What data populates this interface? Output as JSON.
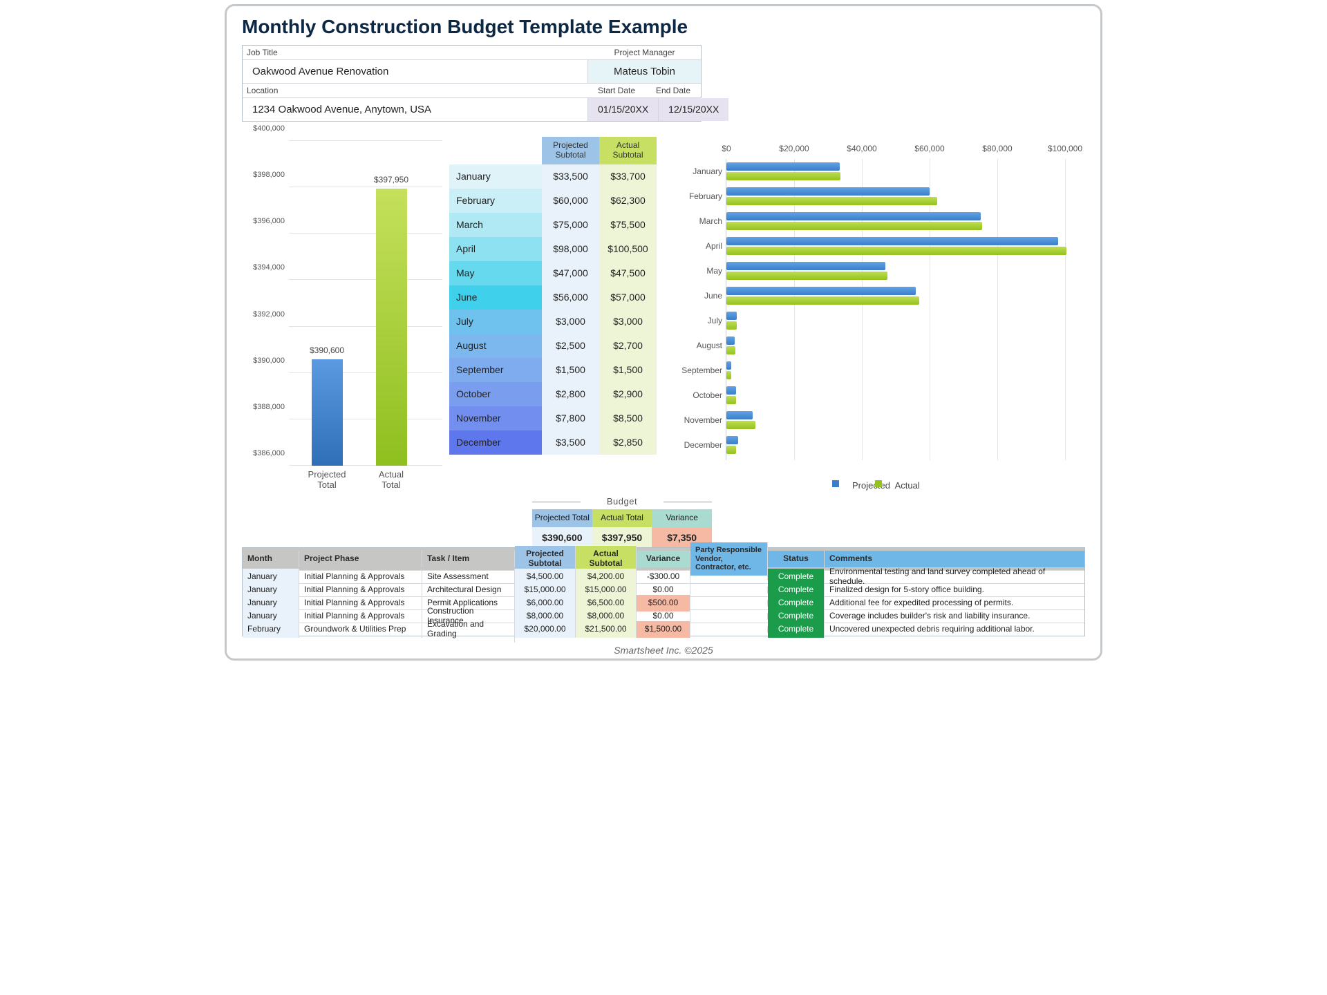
{
  "title": "Monthly Construction Budget Template Example",
  "footer": "Smartsheet Inc. ©2025",
  "header": {
    "job_title_label": "Job Title",
    "job_title": "Oakwood Avenue Renovation",
    "pm_label": "Project Manager",
    "pm": "Mateus Tobin",
    "location_label": "Location",
    "location": "1234 Oakwood Avenue, Anytown, USA",
    "start_label": "Start Date",
    "start": "01/15/20XX",
    "end_label": "End Date",
    "end": "12/15/20XX"
  },
  "chart_data": [
    {
      "type": "bar",
      "categories": [
        "Projected\nTotal",
        "Actual\nTotal"
      ],
      "values": [
        390600,
        397950
      ],
      "data_labels": [
        "$390,600",
        "$397,950"
      ],
      "ylim": [
        386000,
        400000
      ],
      "yticks": [
        "$386,000",
        "$388,000",
        "$390,000",
        "$392,000",
        "$394,000",
        "$396,000",
        "$398,000",
        "$400,000"
      ]
    },
    {
      "type": "bar",
      "orientation": "horizontal",
      "categories": [
        "January",
        "February",
        "March",
        "April",
        "May",
        "June",
        "July",
        "August",
        "September",
        "October",
        "November",
        "December"
      ],
      "series": [
        {
          "name": "Projected",
          "values": [
            33500,
            60000,
            75000,
            98000,
            47000,
            56000,
            3000,
            2500,
            1500,
            2800,
            7800,
            3500
          ]
        },
        {
          "name": "Actual",
          "values": [
            33700,
            62300,
            75500,
            100500,
            47500,
            57000,
            3000,
            2700,
            1500,
            2900,
            8500,
            2850
          ]
        }
      ],
      "xticks": [
        0,
        20000,
        40000,
        60000,
        80000,
        100000
      ],
      "xtick_labels": [
        "$0",
        "$20,000",
        "$40,000",
        "$60,000",
        "$80,000",
        "$100,000"
      ],
      "legend": [
        "Projected",
        "Actual"
      ]
    }
  ],
  "month_table": {
    "headers": {
      "proj": "Projected Subtotal",
      "act": "Actual Subtotal"
    },
    "rows": [
      {
        "m": "January",
        "p": "$33,500",
        "a": "$33,700",
        "c": "#dff3f9"
      },
      {
        "m": "February",
        "p": "$60,000",
        "a": "$62,300",
        "c": "#cbeff7"
      },
      {
        "m": "March",
        "p": "$75,000",
        "a": "$75,500",
        "c": "#b0e9f4"
      },
      {
        "m": "April",
        "p": "$98,000",
        "a": "$100,500",
        "c": "#8de1f1"
      },
      {
        "m": "May",
        "p": "$47,000",
        "a": "$47,500",
        "c": "#67d9ee"
      },
      {
        "m": "June",
        "p": "$56,000",
        "a": "$57,000",
        "c": "#3fd0ec"
      },
      {
        "m": "July",
        "p": "$3,000",
        "a": "$3,000",
        "c": "#6fc2ee"
      },
      {
        "m": "August",
        "p": "$2,500",
        "a": "$2,700",
        "c": "#7cb8ee"
      },
      {
        "m": "September",
        "p": "$1,500",
        "a": "$1,500",
        "c": "#7facee"
      },
      {
        "m": "October",
        "p": "$2,800",
        "a": "$2,900",
        "c": "#7a9dee"
      },
      {
        "m": "November",
        "p": "$7,800",
        "a": "$8,500",
        "c": "#728eee"
      },
      {
        "m": "December",
        "p": "$3,500",
        "a": "$2,850",
        "c": "#5f77ec"
      }
    ]
  },
  "budget": {
    "title": "Budget",
    "headers": [
      "Projected Total",
      "Actual Total",
      "Variance"
    ],
    "values": [
      "$390,600",
      "$397,950",
      "$7,350"
    ]
  },
  "detail": {
    "headers": [
      "Month",
      "Project Phase",
      "Task / Item",
      "Projected Subtotal",
      "Actual Subtotal",
      "Variance",
      "Party Responsible Vendor, Contractor, etc.",
      "Status",
      "Comments"
    ],
    "rows": [
      {
        "m": "January",
        "ph": "Initial Planning & Approvals",
        "t": "Site Assessment",
        "p": "$4,500.00",
        "a": "$4,200.00",
        "v": "-$300.00",
        "pr": "",
        "s": "Complete",
        "c": "Environmental testing and land survey completed ahead of schedule.",
        "vpos": false
      },
      {
        "m": "January",
        "ph": "Initial Planning & Approvals",
        "t": "Architectural Design",
        "p": "$15,000.00",
        "a": "$15,000.00",
        "v": "$0.00",
        "pr": "",
        "s": "Complete",
        "c": "Finalized design for 5-story office building.",
        "vpos": false
      },
      {
        "m": "January",
        "ph": "Initial Planning & Approvals",
        "t": "Permit Applications",
        "p": "$6,000.00",
        "a": "$6,500.00",
        "v": "$500.00",
        "pr": "",
        "s": "Complete",
        "c": "Additional fee for expedited processing of permits.",
        "vpos": true
      },
      {
        "m": "January",
        "ph": "Initial Planning & Approvals",
        "t": "Construction Insurance",
        "p": "$8,000.00",
        "a": "$8,000.00",
        "v": "$0.00",
        "pr": "",
        "s": "Complete",
        "c": "Coverage includes builder's risk and liability insurance.",
        "vpos": false
      },
      {
        "m": "February",
        "ph": "Groundwork & Utilities Prep",
        "t": "Excavation and Grading",
        "p": "$20,000.00",
        "a": "$21,500.00",
        "v": "$1,500.00",
        "pr": "",
        "s": "Complete",
        "c": "Uncovered unexpected debris requiring additional labor.",
        "vpos": true
      }
    ]
  }
}
